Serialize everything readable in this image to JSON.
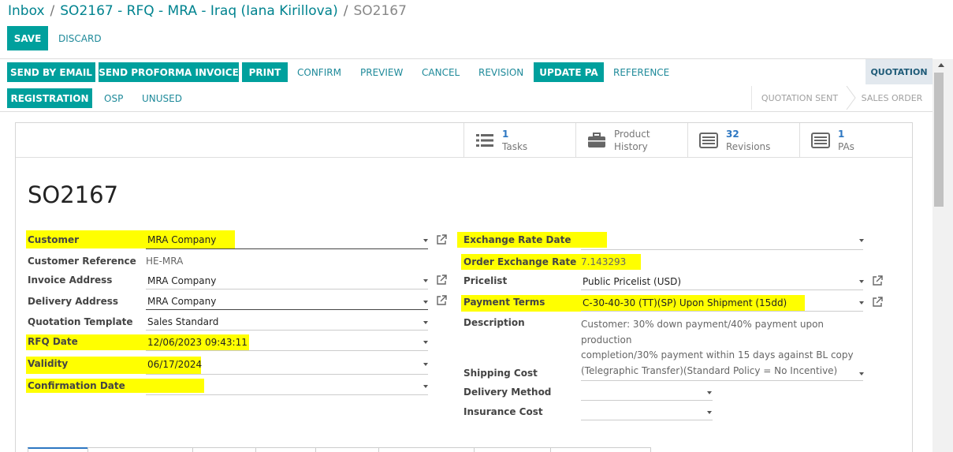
{
  "breadcrumb": {
    "inbox": "Inbox",
    "record": "SO2167 - RFQ - MRA - Iraq (Iana Kirillova)",
    "current": "SO2167",
    "separator": "/"
  },
  "control": {
    "save": "SAVE",
    "discard": "DISCARD"
  },
  "actions": {
    "send_email": "SEND BY EMAIL",
    "send_proforma": "SEND PROFORMA INVOICE",
    "print": "PRINT",
    "confirm": "CONFIRM",
    "preview": "PREVIEW",
    "cancel": "CANCEL",
    "revision": "REVISION",
    "update_pa": "UPDATE PA",
    "reference": "REFERENCE",
    "registration": "REGISTRATION",
    "osp": "OSP",
    "unused": "UNUSED"
  },
  "status": {
    "quotation": "QUOTATION",
    "quotation_sent": "QUOTATION SENT",
    "sales_order": "SALES ORDER"
  },
  "smart_buttons": {
    "tasks": {
      "count": "1",
      "label": "Tasks"
    },
    "product_history": {
      "line1": "Product",
      "line2": "History"
    },
    "revisions": {
      "count": "32",
      "label": "Revisions"
    },
    "pas": {
      "count": "1",
      "label": "PAs"
    }
  },
  "record": {
    "name": "SO2167"
  },
  "left_fields": {
    "customer": {
      "label": "Customer",
      "value": "MRA Company"
    },
    "customer_reference": {
      "label": "Customer Reference",
      "value": "HE-MRA"
    },
    "invoice_address": {
      "label": "Invoice Address",
      "value": "MRA Company"
    },
    "delivery_address": {
      "label": "Delivery Address",
      "value": "MRA Company"
    },
    "quotation_template": {
      "label": "Quotation Template",
      "value": "Sales Standard"
    },
    "rfq_date": {
      "label": "RFQ Date",
      "value": "12/06/2023 09:43:11"
    },
    "validity": {
      "label": "Validity",
      "value": "06/17/2024"
    },
    "confirmation_date": {
      "label": "Confirmation Date",
      "value": ""
    }
  },
  "right_fields": {
    "exchange_rate_date": {
      "label": "Exchange Rate Date",
      "value": ""
    },
    "order_exchange_rate": {
      "label": "Order Exchange Rate",
      "value": "7.143293"
    },
    "pricelist": {
      "label": "Pricelist",
      "value": "Public Pricelist (USD)"
    },
    "payment_terms": {
      "label": "Payment Terms",
      "value": "C-30-40-30 (TT)(SP) Upon Shipment (15dd)"
    },
    "description": {
      "label": "Description",
      "line1": "Customer: 30% down payment/40% payment upon production",
      "line2": "completion/30% payment within 15 days against BL copy",
      "line3": "(Telegraphic Transfer)(Standard Policy = No Incentive)"
    },
    "shipping_cost": {
      "label": "Shipping Cost",
      "value": ""
    },
    "delivery_method": {
      "label": "Delivery Method",
      "value": ""
    },
    "insurance_cost": {
      "label": "Insurance Cost",
      "value": ""
    }
  },
  "colors": {
    "primary": "#00a09d",
    "link": "#1f8a9a",
    "highlight": "#ffff00"
  }
}
